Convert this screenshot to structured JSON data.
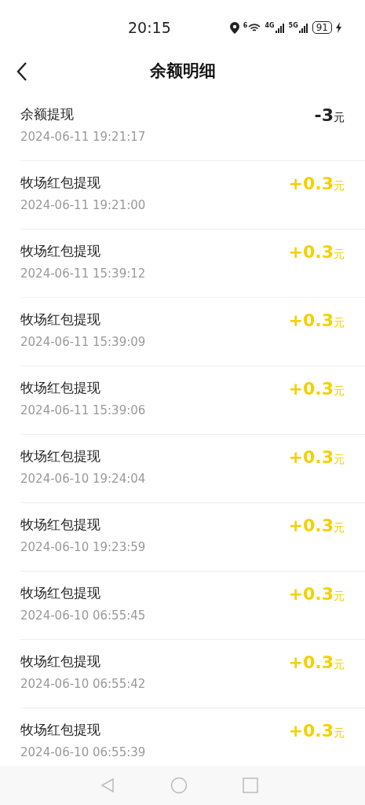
{
  "status_bar": {
    "time": "20:15",
    "wifi_badge": "6",
    "network_1": "4G",
    "network_2": "5G",
    "battery": "91"
  },
  "header": {
    "title": "余额明细"
  },
  "transactions": [
    {
      "title": "余额提现",
      "date": "2024-06-11 19:21:17",
      "amount": "-3",
      "unit": "元",
      "kind": "debit"
    },
    {
      "title": "牧场红包提现",
      "date": "2024-06-11 19:21:00",
      "amount": "+0.3",
      "unit": "元",
      "kind": "credit"
    },
    {
      "title": "牧场红包提现",
      "date": "2024-06-11 15:39:12",
      "amount": "+0.3",
      "unit": "元",
      "kind": "credit"
    },
    {
      "title": "牧场红包提现",
      "date": "2024-06-11 15:39:09",
      "amount": "+0.3",
      "unit": "元",
      "kind": "credit"
    },
    {
      "title": "牧场红包提现",
      "date": "2024-06-11 15:39:06",
      "amount": "+0.3",
      "unit": "元",
      "kind": "credit"
    },
    {
      "title": "牧场红包提现",
      "date": "2024-06-10 19:24:04",
      "amount": "+0.3",
      "unit": "元",
      "kind": "credit"
    },
    {
      "title": "牧场红包提现",
      "date": "2024-06-10 19:23:59",
      "amount": "+0.3",
      "unit": "元",
      "kind": "credit"
    },
    {
      "title": "牧场红包提现",
      "date": "2024-06-10 06:55:45",
      "amount": "+0.3",
      "unit": "元",
      "kind": "credit"
    },
    {
      "title": "牧场红包提现",
      "date": "2024-06-10 06:55:42",
      "amount": "+0.3",
      "unit": "元",
      "kind": "credit"
    },
    {
      "title": "牧场红包提现",
      "date": "2024-06-10 06:55:39",
      "amount": "+0.3",
      "unit": "元",
      "kind": "credit"
    }
  ]
}
